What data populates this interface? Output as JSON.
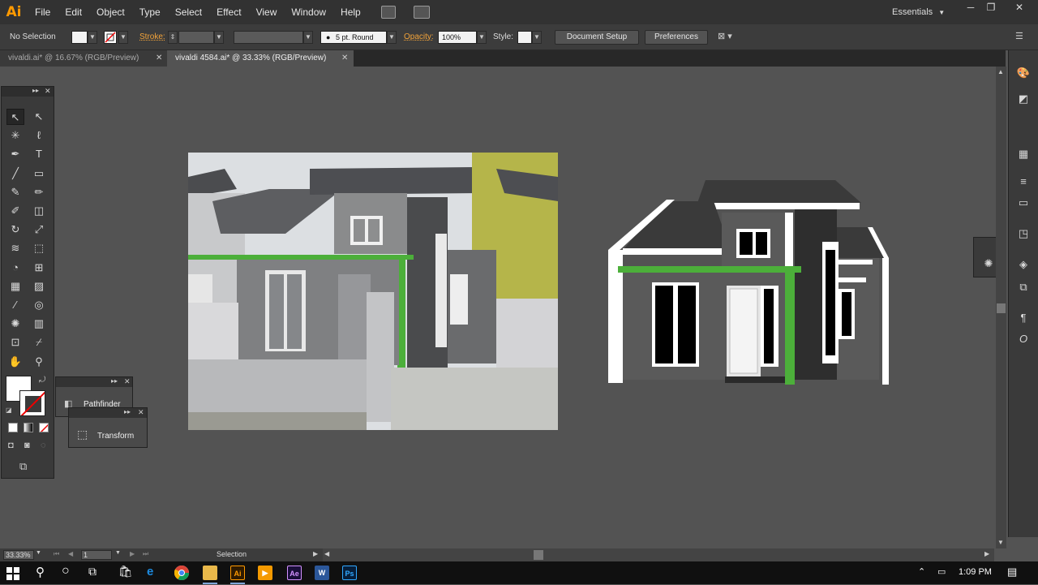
{
  "app": {
    "logo": "Ai",
    "menus": [
      "File",
      "Edit",
      "Object",
      "Type",
      "Select",
      "Effect",
      "View",
      "Window",
      "Help"
    ],
    "workspace": "Essentials",
    "window_controls": [
      "─",
      "❐",
      "✕"
    ]
  },
  "control_bar": {
    "selection": "No Selection",
    "stroke_label": "Stroke:",
    "brush": "5 pt. Round",
    "opacity_label": "Opacity:",
    "opacity_value": "100%",
    "style_label": "Style:",
    "document_setup": "Document Setup",
    "preferences": "Preferences"
  },
  "tabs": [
    {
      "label": "vivaldi.ai* @ 16.67% (RGB/Preview)",
      "active": false
    },
    {
      "label": "vivaldi 4584.ai* @ 33.33% (RGB/Preview)",
      "active": true
    }
  ],
  "tabs_close": "✕",
  "tools": {
    "icons": [
      [
        "selection-tool-icon",
        "direct-selection-tool-icon"
      ],
      [
        "magic-wand-icon",
        "lasso-icon"
      ],
      [
        "pen-tool-icon",
        "type-tool-icon"
      ],
      [
        "line-tool-icon",
        "rectangle-tool-icon"
      ],
      [
        "paintbrush-icon",
        "pencil-icon"
      ],
      [
        "blob-brush-icon",
        "eraser-icon"
      ],
      [
        "rotate-tool-icon",
        "scale-tool-icon"
      ],
      [
        "width-tool-icon",
        "free-transform-icon"
      ],
      [
        "shape-builder-icon",
        "perspective-grid-icon"
      ],
      [
        "mesh-tool-icon",
        "gradient-tool-icon"
      ],
      [
        "eyedropper-icon",
        "blend-tool-icon"
      ],
      [
        "symbol-sprayer-icon",
        "column-graph-icon"
      ],
      [
        "artboard-tool-icon",
        "slice-tool-icon"
      ],
      [
        "hand-tool-icon",
        "zoom-tool-icon"
      ]
    ],
    "glyphs": [
      [
        "↖",
        "↖"
      ],
      [
        "✳",
        "ℓ"
      ],
      [
        "✒",
        "T"
      ],
      [
        "╱",
        "▭"
      ],
      [
        "✎",
        "✏"
      ],
      [
        "✐",
        "◫"
      ],
      [
        "↻",
        "⤢"
      ],
      [
        "≋",
        "⬚"
      ],
      [
        "◔",
        "⊞"
      ],
      [
        "▦",
        "▨"
      ],
      [
        "⁄",
        "◎"
      ],
      [
        "✺",
        "▥"
      ],
      [
        "⊡",
        "⌿"
      ],
      [
        "✋",
        "⚲"
      ]
    ]
  },
  "panels": {
    "pathfinder": "Pathfinder",
    "transform": "Transform",
    "collapse": "▸▸",
    "close": "✕"
  },
  "status": {
    "zoom": "33.33%",
    "artboard": "1",
    "tool": "Selection"
  },
  "taskbar": {
    "time": "1:09 PM",
    "apps": [
      {
        "name": "chrome",
        "glyph": "",
        "color": "#e0a200"
      },
      {
        "name": "folder",
        "glyph": "",
        "color": "#e9b84a"
      },
      {
        "name": "illustrator",
        "glyph": "Ai",
        "color": "#2e1a00"
      },
      {
        "name": "media-player",
        "glyph": "▶",
        "color": "#f59a00"
      },
      {
        "name": "after-effects",
        "glyph": "Ae",
        "color": "#1a0e3a"
      },
      {
        "name": "word",
        "glyph": "W",
        "color": "#2b579a"
      },
      {
        "name": "photoshop",
        "glyph": "Ps",
        "color": "#061e3a"
      }
    ]
  },
  "colors": {
    "accent_orange": "#ff9a00",
    "house_green": "#4caf3a",
    "roof_dark": "#3a3a3a"
  }
}
